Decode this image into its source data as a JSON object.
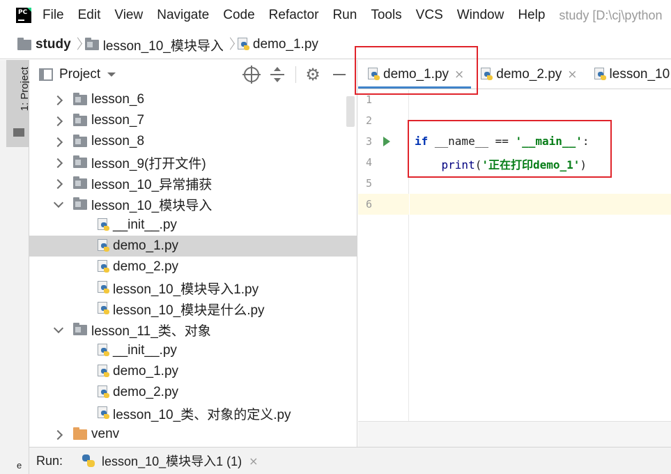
{
  "menubar": {
    "logo": "PC",
    "items": [
      "File",
      "Edit",
      "View",
      "Navigate",
      "Code",
      "Refactor",
      "Run",
      "Tools",
      "VCS",
      "Window",
      "Help"
    ],
    "title": "study [D:\\cj\\python"
  },
  "breadcrumb": {
    "items": [
      "study",
      "lesson_10_模块导入",
      "demo_1.py"
    ]
  },
  "toolstrip": {
    "project_label": "1: Project",
    "bottom_text": "e"
  },
  "project_panel": {
    "title": "Project",
    "tree": [
      {
        "label": "lesson_6",
        "type": "folder",
        "level": 0,
        "expanded": false
      },
      {
        "label": "lesson_7",
        "type": "folder",
        "level": 0,
        "expanded": false
      },
      {
        "label": "lesson_8",
        "type": "folder",
        "level": 0,
        "expanded": false
      },
      {
        "label": "lesson_9(打开文件)",
        "type": "folder",
        "level": 0,
        "expanded": false
      },
      {
        "label": "lesson_10_异常捕获",
        "type": "folder",
        "level": 0,
        "expanded": false
      },
      {
        "label": "lesson_10_模块导入",
        "type": "folder",
        "level": 0,
        "expanded": true
      },
      {
        "label": "__init__.py",
        "type": "py",
        "level": 1
      },
      {
        "label": "demo_1.py",
        "type": "py",
        "level": 1,
        "selected": true
      },
      {
        "label": "demo_2.py",
        "type": "py",
        "level": 1
      },
      {
        "label": "lesson_10_模块导入1.py",
        "type": "py",
        "level": 1
      },
      {
        "label": "lesson_10_模块是什么.py",
        "type": "py",
        "level": 1
      },
      {
        "label": "lesson_11_类、对象",
        "type": "folder",
        "level": 0,
        "expanded": true
      },
      {
        "label": "__init__.py",
        "type": "py",
        "level": 1
      },
      {
        "label": "demo_1.py",
        "type": "py",
        "level": 1
      },
      {
        "label": "demo_2.py",
        "type": "py",
        "level": 1
      },
      {
        "label": "lesson_10_类、对象的定义.py",
        "type": "py",
        "level": 1
      },
      {
        "label": "venv",
        "type": "folder-orange",
        "level": 0,
        "expanded": false
      }
    ]
  },
  "editor_tabs": [
    {
      "label": "demo_1.py",
      "active": true,
      "close": "×"
    },
    {
      "label": "demo_2.py",
      "active": false,
      "close": "×"
    },
    {
      "label": "lesson_10",
      "active": false,
      "close": ""
    }
  ],
  "editor": {
    "line_numbers": [
      "1",
      "2",
      "3",
      "4",
      "5",
      "6"
    ],
    "code": {
      "if": "if",
      "name": " __name__ ",
      "eq": "== ",
      "main_str": "'__main__'",
      "colon": ":",
      "indent": "    ",
      "print": "print",
      "open_paren": "(",
      "print_str": "'正在打印demo_1'",
      "close_paren": ")"
    }
  },
  "runbar": {
    "label": "Run:",
    "tab_label": "lesson_10_模块导入1 (1)",
    "close": "×"
  },
  "colors": {
    "highlight_box": "#e0242b",
    "active_tab_underline": "#4083c9",
    "keyword": "#0033b3",
    "string": "#067d17",
    "selected_row": "#d5d5d5",
    "caret_line": "#fffae3"
  }
}
